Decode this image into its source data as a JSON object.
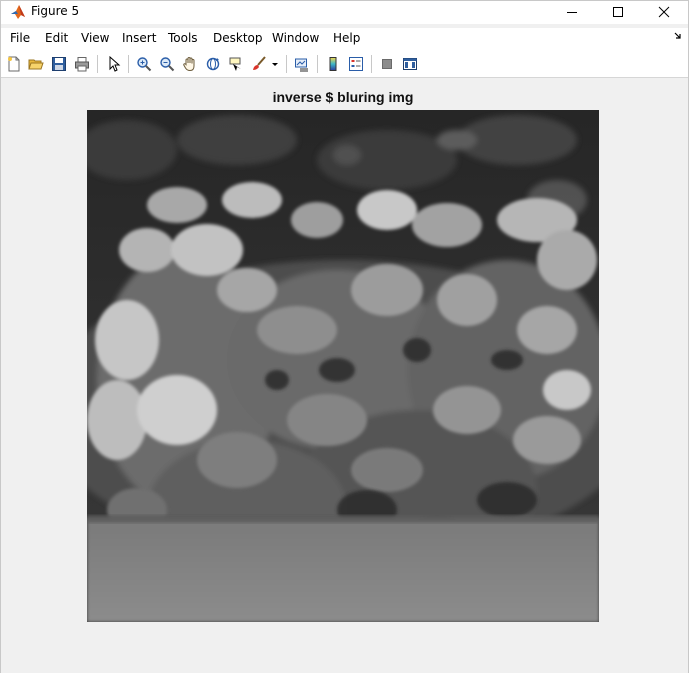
{
  "window": {
    "title": "Figure 5"
  },
  "menu": {
    "items": [
      {
        "label": "File"
      },
      {
        "label": "Edit"
      },
      {
        "label": "View"
      },
      {
        "label": "Insert"
      },
      {
        "label": "Tools"
      },
      {
        "label": "Desktop"
      },
      {
        "label": "Window"
      },
      {
        "label": "Help"
      }
    ]
  },
  "toolbar": {
    "buttons": [
      {
        "icon": "new-figure-icon"
      },
      {
        "icon": "open-file-icon"
      },
      {
        "icon": "save-icon"
      },
      {
        "icon": "print-icon"
      },
      {
        "icon": "edit-plot-arrow-icon"
      },
      {
        "icon": "zoom-in-icon"
      },
      {
        "icon": "zoom-out-icon"
      },
      {
        "icon": "pan-hand-icon"
      },
      {
        "icon": "rotate-3d-icon"
      },
      {
        "icon": "data-cursor-icon"
      },
      {
        "icon": "brush-icon"
      },
      {
        "icon": "link-plot-icon"
      },
      {
        "icon": "insert-colorbar-icon"
      },
      {
        "icon": "insert-legend-icon"
      },
      {
        "icon": "hide-plot-tools-icon"
      },
      {
        "icon": "show-plot-tools-icon"
      }
    ]
  },
  "figure": {
    "title": "inverse $ bluring img",
    "image_description": "grayscale"
  }
}
